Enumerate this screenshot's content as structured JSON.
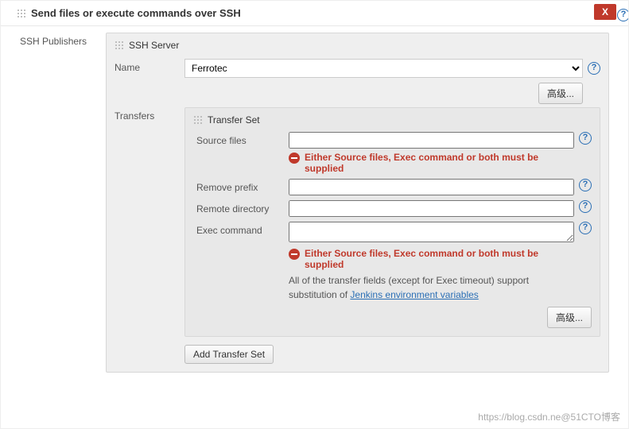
{
  "close_label": "X",
  "section": {
    "title": "Send files or execute commands over SSH"
  },
  "ssh_publishers_label": "SSH Publishers",
  "ssh_server": {
    "panel_label": "SSH Server",
    "name_label": "Name",
    "selected": "Ferrotec",
    "advanced_btn": "高级..."
  },
  "transfers_label": "Transfers",
  "transfer_set": {
    "panel_label": "Transfer Set",
    "source_files_label": "Source files",
    "source_files_value": "",
    "error1": "Either Source files, Exec command or both must be supplied",
    "remove_prefix_label": "Remove prefix",
    "remove_prefix_value": "",
    "remote_dir_label": "Remote directory",
    "remote_dir_value": "",
    "exec_cmd_label": "Exec command",
    "exec_cmd_value": "",
    "error2": "Either Source files, Exec command or both must be supplied",
    "note_prefix": "All of the transfer fields (except for Exec timeout) support substitution of ",
    "note_link": "Jenkins environment variables",
    "advanced_btn": "高级..."
  },
  "add_transfer_btn": "Add Transfer Set",
  "watermark": "https://blog.csdn.ne@51CTO博客"
}
